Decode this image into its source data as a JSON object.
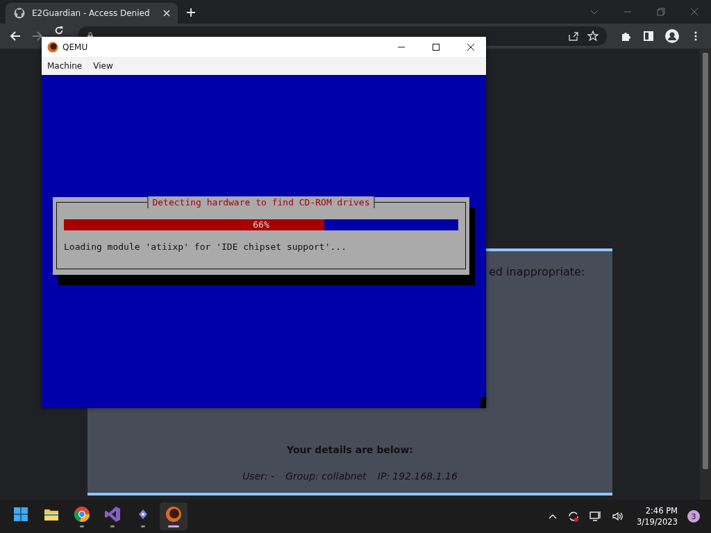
{
  "browser": {
    "tab": {
      "title": "E2Guardian - Access Denied"
    }
  },
  "page": {
    "heading_fragment": "ed inappropriate:",
    "details_heading": "Your details are below:",
    "details": [
      "User: -",
      "Group: collabnet",
      "IP: 192.168.1.16"
    ]
  },
  "qemu": {
    "title": "QEMU",
    "menu": [
      "Machine",
      "View"
    ],
    "dialog": {
      "title": "Detecting hardware to find CD-ROM drives",
      "progress": {
        "level": 0.66,
        "reading": "66%"
      },
      "message": "Loading module 'atiixp' for 'IDE chipset support'..."
    }
  },
  "taskbar": {
    "apps": [
      {
        "kind": "start",
        "running": false,
        "selected": false
      },
      {
        "kind": "folder",
        "running": false,
        "selected": false
      },
      {
        "kind": "chrome",
        "running": true,
        "selected": false
      },
      {
        "kind": "studio",
        "running": true,
        "selected": false
      },
      {
        "kind": "chat",
        "running": true,
        "selected": false
      },
      {
        "kind": "qemu",
        "running": true,
        "selected": true
      }
    ],
    "clock": {
      "time": "2:46 PM",
      "date": "3/19/2023"
    },
    "notification_count": "3"
  }
}
